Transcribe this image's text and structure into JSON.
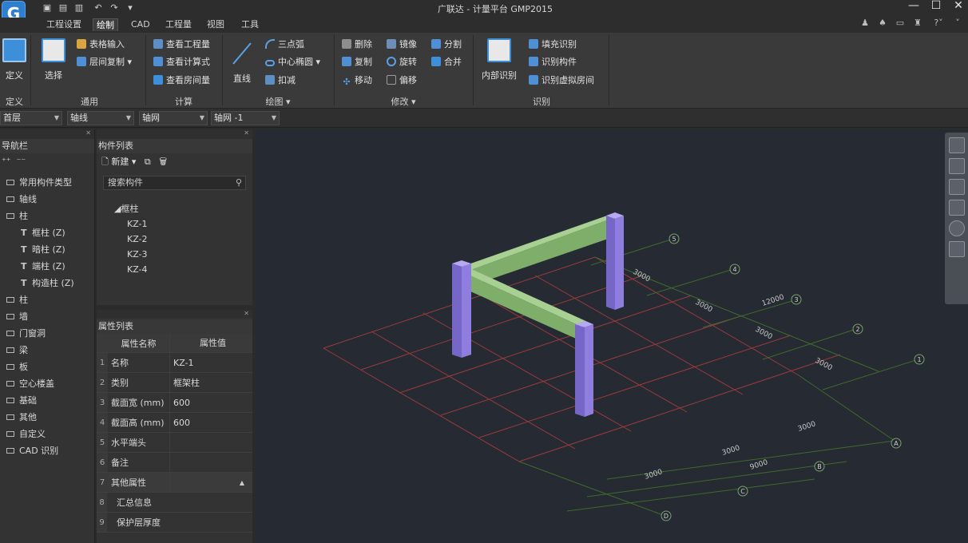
{
  "app": {
    "title": "广联达 - 计量平台 GMP2015",
    "logo_icon": "app-logo-icon",
    "window_controls": [
      "—",
      "☐",
      "✕"
    ]
  },
  "menus": [
    "工程设置",
    "绘制",
    "CAD",
    "工程量",
    "视图",
    "工具"
  ],
  "active_menu": "绘制",
  "ribbon": {
    "groups": {
      "define": {
        "label": "定义",
        "button": "定义"
      },
      "general": {
        "label": "通用",
        "select": "选择",
        "table_input": "表格输入",
        "layer_copy": "层间复制"
      },
      "calc": {
        "label": "计算",
        "items": [
          "查看工程量",
          "查看计算式",
          "查看房间量"
        ]
      },
      "draw": {
        "label": "绘图",
        "line": "直线",
        "items": [
          "三点弧",
          "中心椭圆",
          "扣减"
        ]
      },
      "modify": {
        "label": "修改",
        "col1": [
          "删除",
          "复制",
          "移动"
        ],
        "col2": [
          "镜像",
          "旋转",
          "偏移"
        ],
        "col3": [
          "分割",
          "合并"
        ]
      },
      "recognize": {
        "label": "识别",
        "inner": "内部识别",
        "items": [
          "填充识别",
          "识别构件",
          "识别虚拟房间"
        ]
      }
    }
  },
  "floorbar": {
    "floor": "首层",
    "category": "轴线",
    "type": "轴网",
    "instance": "轴网 -1"
  },
  "nav": {
    "title": "导航栏",
    "items": [
      {
        "label": "常用构件类型",
        "sub": false
      },
      {
        "label": "轴线",
        "sub": false
      },
      {
        "label": "柱",
        "sub": false
      },
      {
        "label": "框柱 (Z)",
        "sub": true
      },
      {
        "label": "暗柱 (Z)",
        "sub": true
      },
      {
        "label": "端柱 (Z)",
        "sub": true
      },
      {
        "label": "构造柱 (Z)",
        "sub": true
      },
      {
        "label": "柱",
        "sub": false
      },
      {
        "label": "墙",
        "sub": false
      },
      {
        "label": "门窗洞",
        "sub": false
      },
      {
        "label": "梁",
        "sub": false
      },
      {
        "label": "板",
        "sub": false
      },
      {
        "label": "空心楼盖",
        "sub": false
      },
      {
        "label": "基础",
        "sub": false
      },
      {
        "label": "其他",
        "sub": false
      },
      {
        "label": "自定义",
        "sub": false
      },
      {
        "label": "CAD 识别",
        "sub": false
      }
    ]
  },
  "component_list": {
    "title": "构件列表",
    "new_label": "新建",
    "search_placeholder": "搜索构件",
    "tree_root": "框柱",
    "items": [
      "KZ-1",
      "KZ-2",
      "KZ-3",
      "KZ-4"
    ]
  },
  "properties": {
    "title": "属性列表",
    "header_name": "属性名称",
    "header_value": "属性值",
    "rows": [
      {
        "num": "1",
        "name": "名称",
        "value": "KZ-1"
      },
      {
        "num": "2",
        "name": "类别",
        "value": "框架柱"
      },
      {
        "num": "3",
        "name": "截面宽 (mm)",
        "value": "600"
      },
      {
        "num": "4",
        "name": "截面高 (mm)",
        "value": "600"
      },
      {
        "num": "5",
        "name": "水平端头",
        "value": ""
      },
      {
        "num": "6",
        "name": "备注",
        "value": ""
      },
      {
        "num": "7",
        "name": "其他属性",
        "value": ""
      },
      {
        "num": "8",
        "name": "汇总信息",
        "value": ""
      },
      {
        "num": "9",
        "name": "保护层厚度",
        "value": ""
      }
    ]
  },
  "viewport": {
    "axis_labels_num": [
      "5",
      "4",
      "3",
      "2",
      "1"
    ],
    "axis_labels_alpha": [
      "A",
      "B",
      "C",
      "D"
    ],
    "dim_labels": [
      "3000",
      "3000",
      "12000",
      "3000",
      "3000",
      "3000",
      "3000",
      "9000",
      "3000"
    ],
    "colors": {
      "background": "#252a33",
      "grid_red": "#9a3b3b",
      "grid_green": "#3f6b2c",
      "column": "#8f7ee0",
      "beam": "#7fae6a"
    }
  }
}
